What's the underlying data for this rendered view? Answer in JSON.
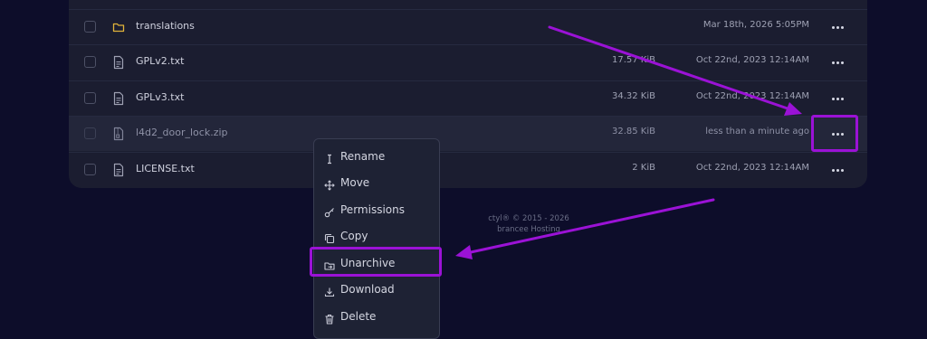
{
  "files": [
    {
      "name": "translations",
      "size": "",
      "date": "Mar 18th, 2026 5:05PM",
      "icon": "folder-icon"
    },
    {
      "name": "GPLv2.txt",
      "size": "17.57 KiB",
      "date": "Oct 22nd, 2023 12:14AM",
      "icon": "file-text-icon"
    },
    {
      "name": "GPLv3.txt",
      "size": "34.32 KiB",
      "date": "Oct 22nd, 2023 12:14AM",
      "icon": "file-text-icon"
    },
    {
      "name": "l4d2_door_lock.zip",
      "size": "32.85 KiB",
      "date": "less than a minute ago",
      "icon": "file-archive-icon"
    },
    {
      "name": "LICENSE.txt",
      "size": "2 KiB",
      "date": "Oct 22nd, 2023 12:14AM",
      "icon": "file-text-icon"
    }
  ],
  "footer": {
    "line1": "ctyl® © 2015 - 2026",
    "line2": "brancee Hosting"
  },
  "context_menu": {
    "items": [
      {
        "label": "Rename",
        "icon": "text-cursor-icon"
      },
      {
        "label": "Move",
        "icon": "move-arrows-icon"
      },
      {
        "label": "Permissions",
        "icon": "key-icon"
      },
      {
        "label": "Copy",
        "icon": "copy-icon"
      },
      {
        "label": "Unarchive",
        "icon": "folder-open-icon"
      },
      {
        "label": "Download",
        "icon": "download-icon"
      },
      {
        "label": "Delete",
        "icon": "trash-icon"
      }
    ]
  },
  "colors": {
    "background": "#0d0d2a",
    "panel": "#1b1d30",
    "highlight_annotation": "#9b12d6",
    "folder": "#e0b23a"
  }
}
